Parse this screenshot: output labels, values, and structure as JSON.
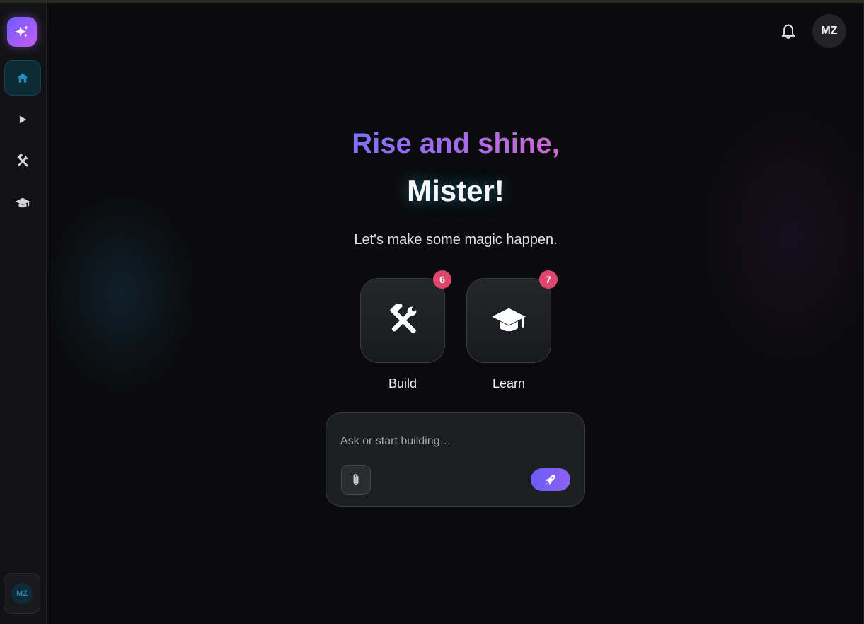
{
  "sidebar": {
    "brand_icon": "sparkles-icon",
    "items": [
      {
        "name": "home",
        "icon": "home-icon",
        "active": true
      },
      {
        "name": "play",
        "icon": "play-icon",
        "active": false
      },
      {
        "name": "build",
        "icon": "tools-icon",
        "active": false
      },
      {
        "name": "learn",
        "icon": "graduation-cap-icon",
        "active": false
      }
    ],
    "profile_initials": "MZ"
  },
  "header": {
    "bell_icon": "bell-icon",
    "avatar_initials": "MZ"
  },
  "hero": {
    "greeting": "Rise and shine,",
    "name": "Mister!",
    "subtitle": "Let's make some magic happen."
  },
  "tiles": [
    {
      "label": "Build",
      "badge": "6",
      "icon": "tools-icon"
    },
    {
      "label": "Learn",
      "badge": "7",
      "icon": "graduation-cap-icon"
    }
  ],
  "composer": {
    "placeholder": "Ask or start building…",
    "value": "",
    "attach_icon": "paperclip-icon",
    "send_icon": "rocket-icon"
  },
  "colors": {
    "accent_gradient_start": "#6d72ff",
    "accent_gradient_end": "#e766c8",
    "badge": "#e0456d",
    "active_nav": "#0b2b35",
    "send_button": "#7a5ff4"
  }
}
